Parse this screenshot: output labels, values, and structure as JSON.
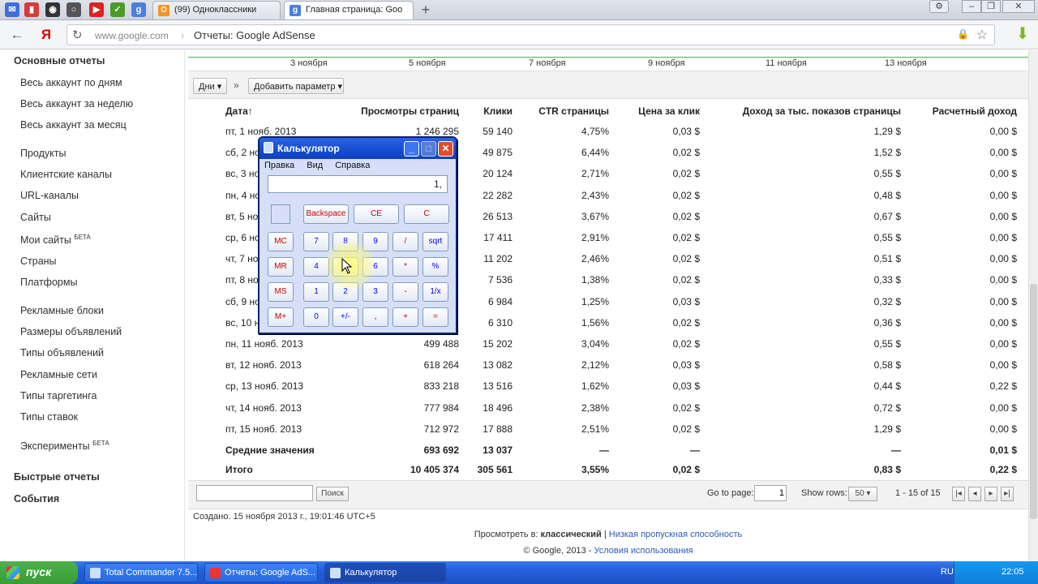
{
  "browser": {
    "tabs": [
      {
        "title": "(99) Одноклассники",
        "favicon": "odnoklassniki-icon",
        "color": "#f7931e"
      },
      {
        "title": "Главная страница: Goo",
        "favicon": "google-icon",
        "color": "#4a7fe0"
      }
    ],
    "new_tab": "+",
    "address": {
      "host": "www.google.com",
      "separator": "›",
      "page_title": "Отчеты: Google AdSense"
    }
  },
  "sidebar": {
    "sections": [
      {
        "heading": "Основные отчеты"
      },
      {
        "item": "Весь аккаунт по дням"
      },
      {
        "item": "Весь аккаунт за неделю"
      },
      {
        "item": "Весь аккаунт за месяц"
      },
      {
        "item": "Продукты"
      },
      {
        "item": "Клиентские каналы"
      },
      {
        "item": "URL-каналы"
      },
      {
        "item": "Сайты"
      },
      {
        "item": "Мои сайты",
        "badge": "БЕТА"
      },
      {
        "item": "Страны"
      },
      {
        "item": "Платформы"
      },
      {
        "item": "Рекламные блоки"
      },
      {
        "item": "Размеры объявлений"
      },
      {
        "item": "Типы объявлений"
      },
      {
        "item": "Рекламные сети"
      },
      {
        "item": "Типы таргетинга"
      },
      {
        "item": "Типы ставок"
      },
      {
        "item": "Эксперименты",
        "badge": "БЕТА"
      },
      {
        "heading": "Быстрые отчеты"
      },
      {
        "heading": "События"
      }
    ]
  },
  "axis_labels": [
    "3 ноября",
    "5 ноября",
    "7 ноября",
    "9 ноября",
    "11 ноября",
    "13 ноября"
  ],
  "controls": {
    "granularity": "Дни",
    "add_param": "Добавить параметр",
    "arrow": "»"
  },
  "table": {
    "headers": [
      "Дата",
      "Просмотры страниц",
      "Клики",
      "CTR страницы",
      "Цена за клик",
      "Доход за тыс. показов страницы",
      "Расчетный доход"
    ],
    "sort_indicator": "↑",
    "rows": [
      [
        "пт, 1 нояб. 2013",
        "1 246 295",
        "59 140",
        "4,75%",
        "0,03 $",
        "1,29 $",
        "0,00 $"
      ],
      [
        "сб, 2 но",
        "",
        "49 875",
        "6,44%",
        "0,02 $",
        "1,52 $",
        "0,00 $"
      ],
      [
        "вс, 3 но",
        "",
        "20 124",
        "2,71%",
        "0,02 $",
        "0,55 $",
        "0,00 $"
      ],
      [
        "пн, 4 но",
        "",
        "22 282",
        "2,43%",
        "0,02 $",
        "0,48 $",
        "0,00 $"
      ],
      [
        "вт, 5 но",
        "",
        "26 513",
        "3,67%",
        "0,02 $",
        "0,67 $",
        "0,00 $"
      ],
      [
        "ср, 6 но",
        "",
        "17 411",
        "2,91%",
        "0,02 $",
        "0,55 $",
        "0,00 $"
      ],
      [
        "чт, 7 но",
        "",
        "11 202",
        "2,46%",
        "0,02 $",
        "0,51 $",
        "0,00 $"
      ],
      [
        "пт, 8 но",
        "",
        "7 536",
        "1,38%",
        "0,02 $",
        "0,33 $",
        "0,00 $"
      ],
      [
        "сб, 9 но",
        "",
        "6 984",
        "1,25%",
        "0,03 $",
        "0,32 $",
        "0,00 $"
      ],
      [
        "вс, 10 н",
        "",
        "6 310",
        "1,56%",
        "0,02 $",
        "0,36 $",
        "0,00 $"
      ],
      [
        "пн, 11 нояб. 2013",
        "499 488",
        "15 202",
        "3,04%",
        "0,02 $",
        "0,55 $",
        "0,00 $"
      ],
      [
        "вт, 12 нояб. 2013",
        "618 264",
        "13 082",
        "2,12%",
        "0,03 $",
        "0,58 $",
        "0,00 $"
      ],
      [
        "ср, 13 нояб. 2013",
        "833 218",
        "13 516",
        "1,62%",
        "0,03 $",
        "0,44 $",
        "0,22 $"
      ],
      [
        "чт, 14 нояб. 2013",
        "777 984",
        "18 496",
        "2,38%",
        "0,02 $",
        "0,72 $",
        "0,00 $"
      ],
      [
        "пт, 15 нояб. 2013",
        "712 972",
        "17 888",
        "2,51%",
        "0,02 $",
        "1,29 $",
        "0,00 $"
      ]
    ],
    "avg": [
      "Средние значения",
      "693 692",
      "13 037",
      "—",
      "—",
      "—",
      "0,01 $"
    ],
    "total": [
      "Итого",
      "10 405 374",
      "305 561",
      "3,55%",
      "0,02 $",
      "0,83 $",
      "0,22 $"
    ]
  },
  "pager": {
    "search_btn": "Поиск",
    "goto_label": "Go to page:",
    "goto_value": "1",
    "rows_label": "Show rows:",
    "rows_value": "50",
    "range": "1 - 15 of 15"
  },
  "footer": {
    "created": "Создано. 15 ноября 2013 г., 19:01:46 UTC+5",
    "view_label": "Просмотреть в:",
    "view_current": "классический",
    "view_link": "Низкая пропускная способность",
    "copyright": "© Google, 2013 -",
    "terms": "Условия использования"
  },
  "calculator": {
    "title": "Калькулятор",
    "menu": [
      "Правка",
      "Вид",
      "Справка"
    ],
    "display": "1,",
    "top_buttons": [
      "Backspace",
      "CE",
      "C"
    ],
    "rows": [
      [
        "MC",
        "7",
        "8",
        "9",
        "/",
        "sqrt"
      ],
      [
        "MR",
        "4",
        "5",
        "6",
        "*",
        "%"
      ],
      [
        "MS",
        "1",
        "2",
        "3",
        "-",
        "1/x"
      ],
      [
        "M+",
        "0",
        "+/-",
        ",",
        "+",
        "="
      ]
    ]
  },
  "taskbar": {
    "start": "пуск",
    "tasks": [
      "Total Commander 7.5...",
      "Отчеты: Google AdS...",
      "Калькулятор"
    ],
    "lang": "RU",
    "clock": "22:05"
  }
}
